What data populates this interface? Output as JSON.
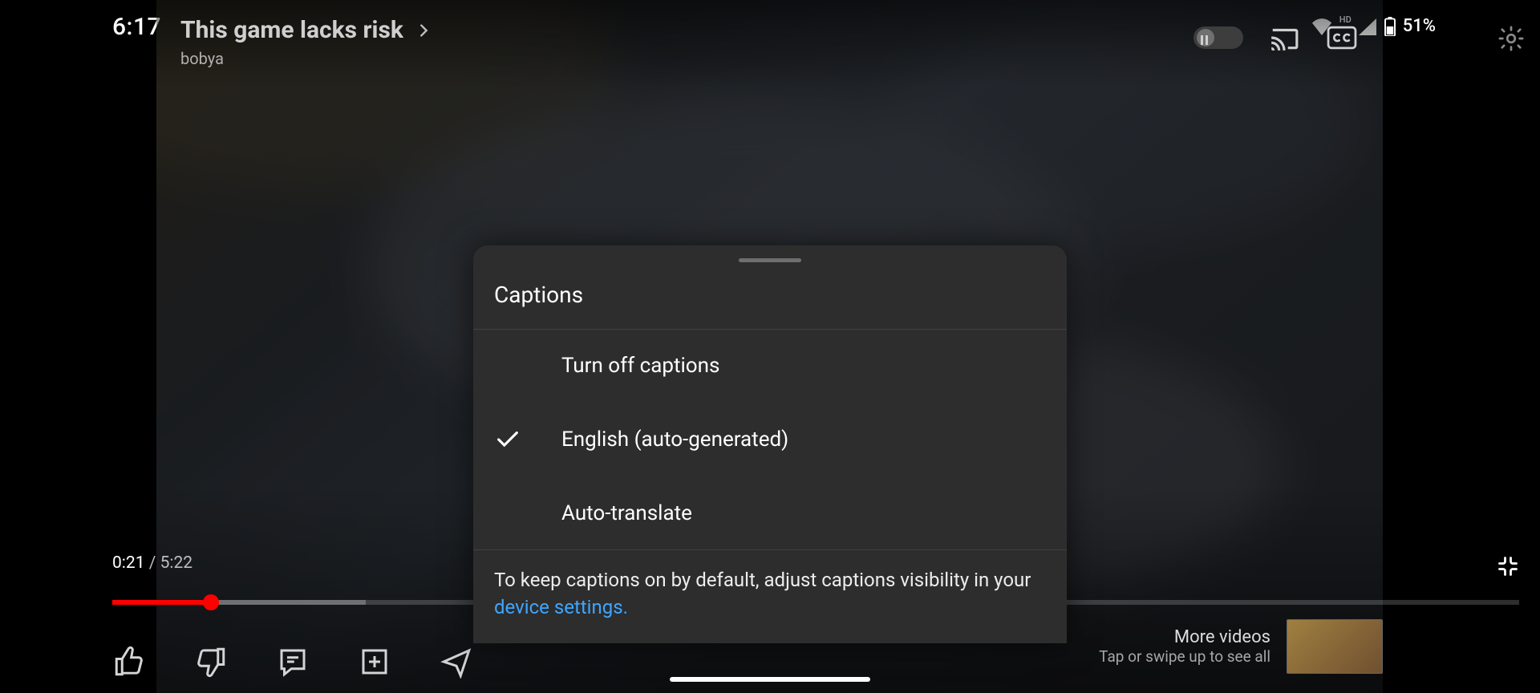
{
  "status_bar": {
    "time": "6:17",
    "battery_percent": "51%",
    "hd_label": "HD"
  },
  "header": {
    "title": "This game lacks risk",
    "channel": "bobya"
  },
  "player": {
    "current_time": "0:21",
    "duration": "5:22"
  },
  "more_videos": {
    "title": "More videos",
    "subtitle": "Tap or swipe up to see all"
  },
  "captions_modal": {
    "heading": "Captions",
    "items": {
      "turn_off": "Turn off captions",
      "english_auto": "English (auto-generated)",
      "auto_translate": "Auto-translate"
    },
    "footer_pre": "To keep captions on by default, adjust captions visibility in your ",
    "footer_link": "device settings."
  }
}
